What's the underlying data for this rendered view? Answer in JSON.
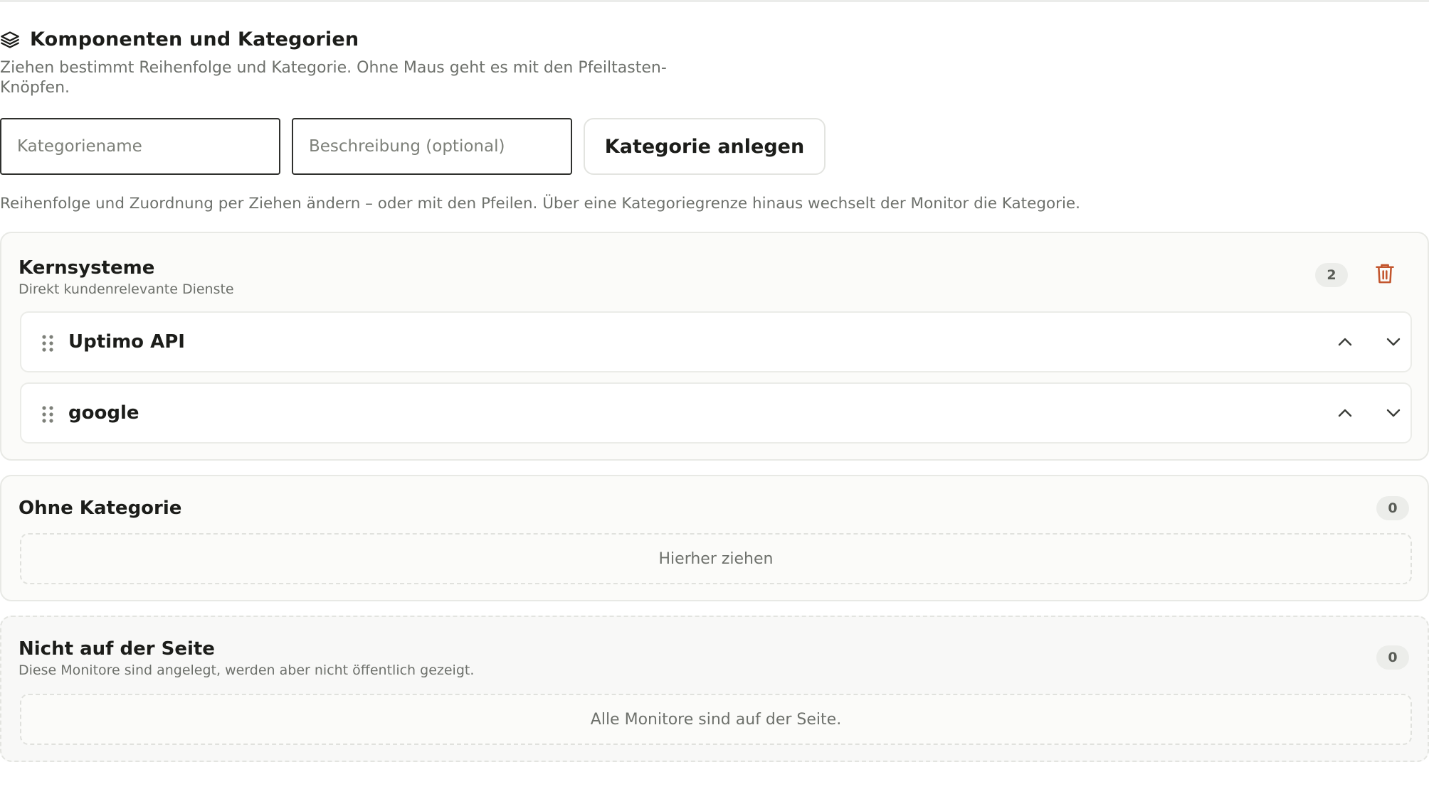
{
  "header": {
    "title": "Komponenten und Kategorien",
    "title_icon": "layers-icon",
    "subtitle": "Ziehen bestimmt Reihenfolge und Kategorie. Ohne Maus geht es mit den Pfeiltasten-Knöpfen."
  },
  "form": {
    "name_placeholder": "Kategoriename",
    "name_value": "",
    "description_placeholder": "Beschreibung (optional)",
    "description_value": "",
    "create_label": "Kategorie anlegen"
  },
  "hint": "Reihenfolge und Zuordnung per Ziehen ändern – oder mit den Pfeilen. Über eine Kategoriegrenze hinaus wechselt der Monitor die Kategorie.",
  "categories": [
    {
      "name": "Kernsysteme",
      "description": "Direkt kundenrelevante Dienste",
      "count": "2",
      "delete_icon": "trash-icon",
      "monitors": [
        {
          "name": "Uptimo API"
        },
        {
          "name": "google"
        }
      ]
    },
    {
      "name": "Ohne Kategorie",
      "count": "0",
      "empty_text": "Hierher ziehen"
    },
    {
      "name": "Nicht auf der Seite",
      "description": "Diese Monitore sind angelegt, werden aber nicht öffentlich gezeigt.",
      "count": "0",
      "empty_text": "Alle Monitore sind auf der Seite."
    }
  ],
  "colors": {
    "text": "#1c1d1a",
    "muted": "#6e716c",
    "danger": "#c2552d",
    "card_bg": "#fbfbf9",
    "border": "#e8e9e5"
  }
}
